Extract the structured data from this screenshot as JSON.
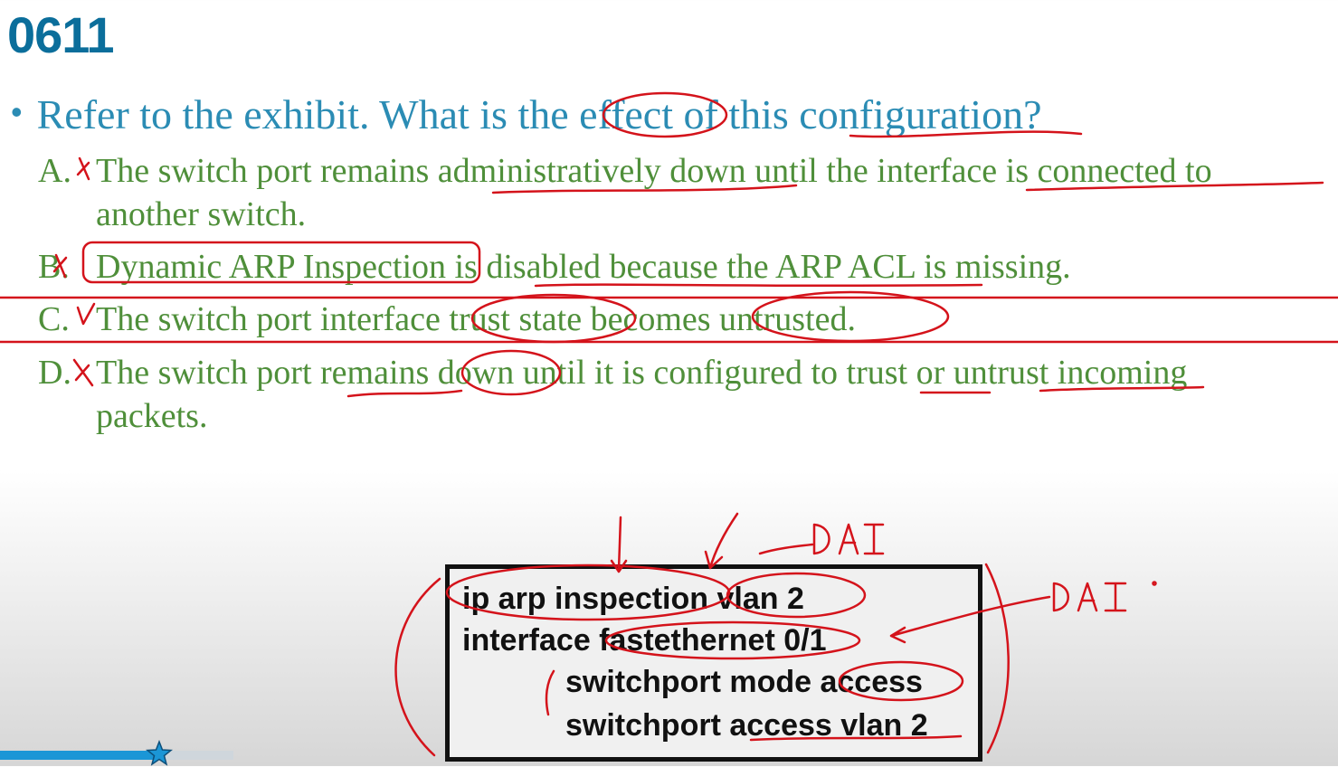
{
  "slide": {
    "title": "0611"
  },
  "question": {
    "bullet": "•",
    "text": "Refer to the exhibit. What is the effect of this configuration?"
  },
  "options": [
    {
      "letter": "A.",
      "text": "The switch port remains administratively down until the interface is connected to",
      "continuation": "another switch.",
      "mark": "cross"
    },
    {
      "letter": "B.",
      "text": "Dynamic ARP Inspection is disabled because the ARP ACL is missing.",
      "mark": "cross"
    },
    {
      "letter": "C.",
      "text": "The switch port interface trust state becomes untrusted.",
      "mark": "check"
    },
    {
      "letter": "D.",
      "text": "The switch port remains down until it is configured to trust or untrust incoming",
      "continuation": "packets.",
      "mark": "cross"
    }
  ],
  "exhibit": {
    "lines": [
      "ip arp inspection vlan 2",
      "interface fastethernet 0/1",
      "switchport mode access",
      "switchport access vlan 2"
    ]
  },
  "annotations": {
    "label_1": "DAI",
    "label_2": "DAI ."
  },
  "player": {
    "progress": 0.68,
    "thumb_icon": "star-icon"
  },
  "colors": {
    "title": "#0b6e9b",
    "question": "#2b8cb4",
    "options": "#4f8f3a",
    "ink": "#d4131b"
  }
}
